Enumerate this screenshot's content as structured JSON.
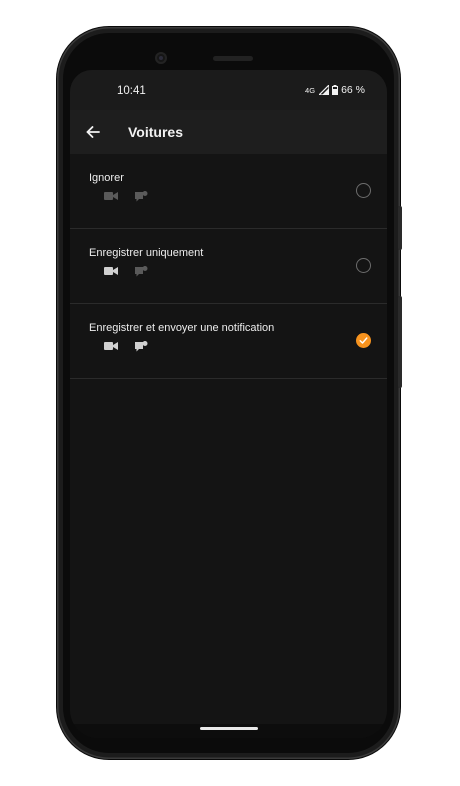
{
  "status_bar": {
    "time": "10:41",
    "network": "4G",
    "battery": "66 %"
  },
  "app_bar": {
    "title": "Voitures"
  },
  "options": [
    {
      "label": "Ignorer",
      "selected": false,
      "video_enabled": false,
      "notification_enabled": false
    },
    {
      "label": "Enregistrer uniquement",
      "selected": false,
      "video_enabled": true,
      "notification_enabled": false
    },
    {
      "label": "Enregistrer et envoyer une notification",
      "selected": true,
      "video_enabled": true,
      "notification_enabled": true
    }
  ],
  "colors": {
    "accent": "#f7931e",
    "background": "#141414",
    "icon_enabled": "#d0d0d0",
    "icon_disabled": "#5a5a5a"
  }
}
